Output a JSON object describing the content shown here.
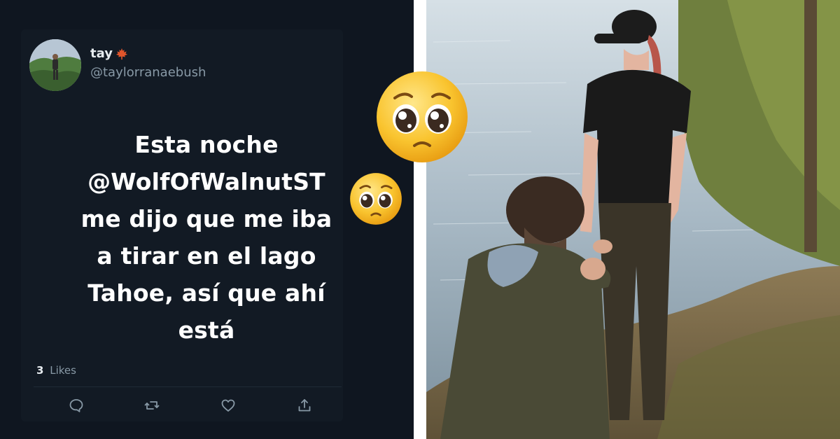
{
  "tweet": {
    "display_name": "tay",
    "name_badge_icon": "maple-leaf-icon",
    "handle": "@taylorranaebush",
    "text_lines": [
      "Esta noche",
      "@WolfOfWalnutST",
      "me dijo que me iba",
      "a tirar en el lago",
      "Tahoe, así que ahí",
      "está"
    ],
    "likes_count": "3",
    "likes_label": "Likes",
    "actions": [
      "reply-icon",
      "retweet-icon",
      "like-icon",
      "share-icon"
    ]
  },
  "emojis": [
    "pleading-face-emoji",
    "pleading-face-emoji"
  ],
  "photo": {
    "subject": "man-kneeling-proposal-by-lake-photo"
  },
  "colors": {
    "panel_bg": "#0f1620",
    "text_primary": "#ffffff",
    "text_secondary": "#8899a6",
    "leaf_accent": "#e0552b",
    "emoji_yellow": "#f7c325"
  }
}
